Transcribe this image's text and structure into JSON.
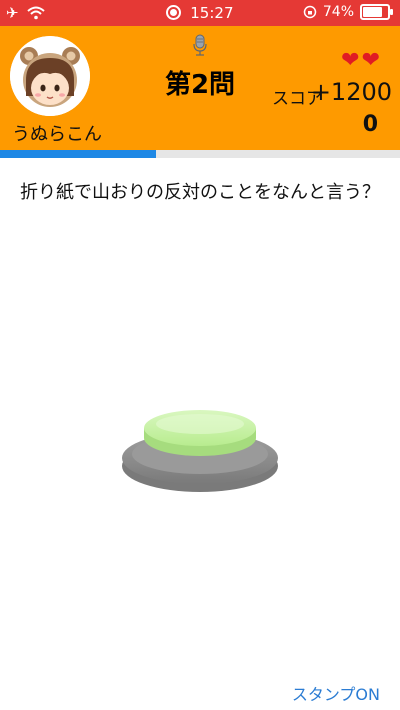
{
  "status_bar": {
    "time": "15:27",
    "battery": "74%",
    "battery_level": 0.74,
    "icons": [
      "airplane-icon",
      "wifi-icon",
      "screen-record-icon",
      "rotation-lock-icon",
      "battery-icon"
    ]
  },
  "header": {
    "username": "うぬらこん",
    "question_number": "第2問",
    "lives": 2,
    "score_label": "スコア",
    "score_delta": "+1200",
    "score_value": "0"
  },
  "progress": {
    "fraction": 0.39
  },
  "question": {
    "text": "折り紙で山おりの反対のことをなんと言う？"
  },
  "stamp_toggle": {
    "label": "スタンプON"
  },
  "colors": {
    "status_bar": "#e53935",
    "header": "#fe9a00",
    "progress_fill": "#1e88e5",
    "progress_track": "#e6e6e6",
    "heart": "#e01b24",
    "buzzer_top": "#c7f0a6",
    "buzzer_base": "#8f8f8f",
    "link": "#2b7cd3"
  }
}
